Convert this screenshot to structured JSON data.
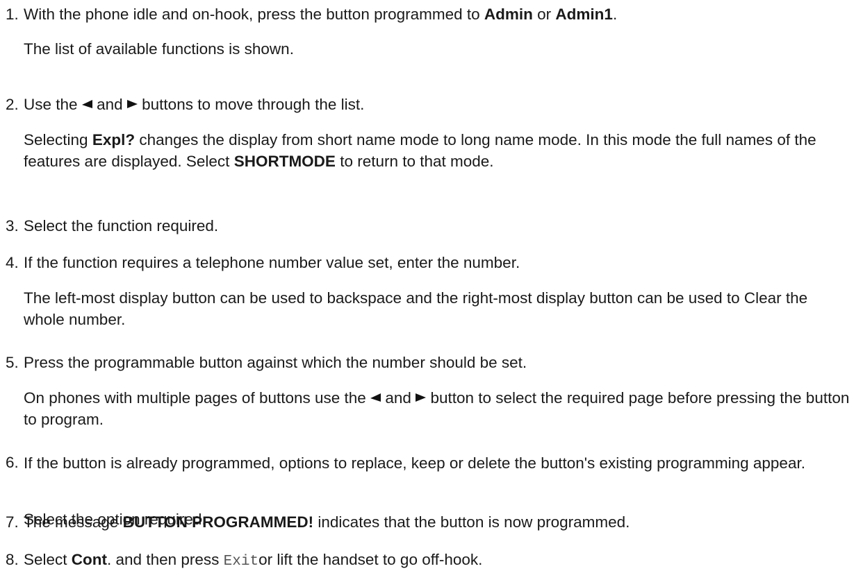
{
  "steps": [
    {
      "num": "1.",
      "main": {
        "pre": "With the phone idle and on-hook, press the button programmed to ",
        "b1": "Admin",
        "mid": " or ",
        "b2": "Admin1",
        "post": "."
      },
      "note": "The list of available functions is shown."
    },
    {
      "num": "2.",
      "main": {
        "pre": "Use the",
        "and": "and",
        "post": "buttons to move through the list."
      },
      "note": {
        "pre": "Selecting ",
        "b1": "Expl?",
        "mid": " changes the display from short name mode to long name mode. In this mode the full names of the features are displayed. Select ",
        "b2": "SHORTMODE",
        "post": " to return to that mode."
      }
    },
    {
      "num": "3.",
      "main": "Select the function required."
    },
    {
      "num": "4.",
      "main": "If the function requires a telephone number value set, enter the number.",
      "note": "The left-most display button can be used to backspace and the right-most display button can be used to Clear the whole number."
    },
    {
      "num": "5.",
      "main": "Press the programmable button against which the number should be set.",
      "note": {
        "pre": "On phones with multiple pages of buttons use the",
        "and": "and",
        "post": "button to select the required page before pressing the button to program."
      }
    },
    {
      "num": "6.",
      "main": "If the button is already programmed, options to replace, keep or delete the button's existing programming appear.",
      "note": "Select the option required."
    },
    {
      "num": "7.",
      "main": {
        "pre": "The message ",
        "b1": "BUTTON PROGRAMMED!",
        "post": " indicates that the button is now programmed."
      }
    },
    {
      "num": "8.",
      "main": {
        "pre": "Select ",
        "b1": "Cont",
        "mid": ". and then press ",
        "code": "Exit",
        "post": "or lift the handset to go off-hook."
      }
    }
  ],
  "icons": {
    "left": "left-arrow-icon",
    "right": "right-arrow-icon"
  }
}
